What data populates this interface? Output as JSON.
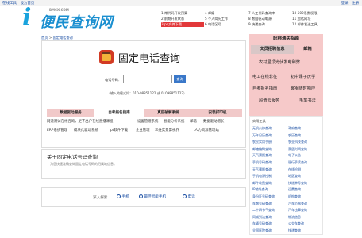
{
  "topbar": {
    "left_links": [
      "在线工具",
      "设为首页"
    ],
    "right_links": [
      "登录",
      "注册"
    ]
  },
  "logo": {
    "mark": "i",
    "name": "便民查询网",
    "domain": "BMCX.COM"
  },
  "nav": {
    "items": [
      "1 常代码开发预算",
      "4 邮编",
      "7 人工代码查询库",
      "10 500系数权限",
      "2 前期开发状态",
      "5 个人简历工作",
      "8 数据驱动电源",
      "11 超话网址",
      "3 pd文件下载",
      "6 电话区号",
      "9 快递查询",
      "12 邮件发送工具"
    ],
    "highlight_index": 8
  },
  "breadcrumb": {
    "home": "首页",
    "sep": " > ",
    "current": "固定电话查询"
  },
  "hero": {
    "title": "固定电话查询"
  },
  "query": {
    "label": "电话号码：",
    "value": "",
    "placeholder": "",
    "button": "查询",
    "hint": "（输入的格式如：010-98851122 或 01098851122）"
  },
  "tabs": [
    {
      "label": "数据驱动服务",
      "active": false
    },
    {
      "label": "自考报名指南",
      "active": true
    },
    {
      "label": "真空破解系统",
      "active": false
    },
    {
      "label": "安装打印机",
      "active": false
    }
  ],
  "link_rows": [
    [
      "网速测试在线咨询，足不出户在线直播课程",
      "设备管理系统",
      "智能分析系统",
      "邮箱",
      "数据驱动增长"
    ],
    [
      "ERP系统管理",
      "模块化驱动系统",
      "pt软件下载",
      "企业管理",
      "三维实景影视界",
      "人力资源管理站"
    ]
  ],
  "about": {
    "title": "关于固定电话号码查询",
    "desc": "为您快速准确查询固定电话号码的归属地信息。"
  },
  "deep_search": {
    "label": "深入探索",
    "keywords": [
      "手机",
      "最佳智能手机",
      "电话"
    ]
  },
  "sidebar": {
    "header": "职称通关指南",
    "tab_active": "文员招聘信息",
    "tab_other": "邮箱",
    "items": [
      "农村屋顶光伏发电利弊",
      "电工在线非征",
      "初中课子厌学",
      "自考报名指南",
      "客服随时响应",
      "超值云服务",
      "毛笔书法"
    ]
  },
  "tools": {
    "title": "实用工具",
    "items": [
      "无机火炉查询",
      "政府查询",
      "万年日历查询",
      "农历查询",
      "农民实用手册",
      "农业科技查询",
      "邮箱编码查询",
      "家居时间查询",
      "天气预报查询",
      "电子公告",
      "手机号码查询",
      "银行手续查询",
      "天气预报查询",
      "在线检测",
      "手机电源控制",
      "地区查询",
      "邮件收费查询",
      "快递单号查询",
      "IP地址查询",
      "运费查询",
      "身份证号码查询",
      "机构查询",
      "车牌号码查询",
      "汽车价格查询",
      "二十四节气查询",
      "汽车违章查询",
      "同城到达查询",
      "物流信息",
      "车辆号码查询",
      "公交车查询",
      "全国医院查询",
      "快递查询"
    ]
  }
}
